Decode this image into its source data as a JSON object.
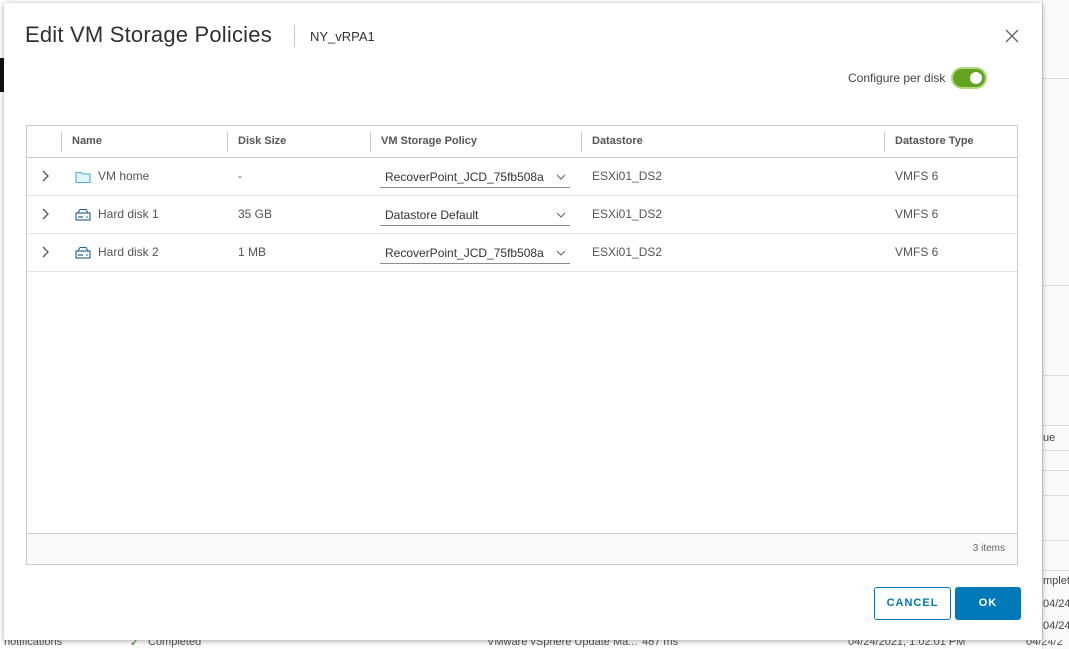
{
  "dialog": {
    "title": "Edit VM Storage Policies",
    "vm_name": "NY_vRPA1",
    "toggle_label": "Configure per disk",
    "toggle_on": true
  },
  "grid": {
    "columns": [
      "Name",
      "Disk Size",
      "VM Storage Policy",
      "Datastore",
      "Datastore Type"
    ],
    "rows": [
      {
        "icon": "folder-icon",
        "name": "VM home",
        "disk_size": "-",
        "policy": "RecoverPoint_JCD_75fb508a",
        "datastore": "ESXi01_DS2",
        "datastore_type": "VMFS 6"
      },
      {
        "icon": "hard-disk-icon",
        "name": "Hard disk 1",
        "disk_size": "35 GB",
        "policy": "Datastore Default",
        "datastore": "ESXi01_DS2",
        "datastore_type": "VMFS 6"
      },
      {
        "icon": "hard-disk-icon",
        "name": "Hard disk 2",
        "disk_size": "1 MB",
        "policy": "RecoverPoint_JCD_75fb508a",
        "datastore": "ESXi01_DS2",
        "datastore_type": "VMFS 6"
      }
    ],
    "footer_count": "3 items"
  },
  "buttons": {
    "cancel": "CANCEL",
    "ok": "OK"
  },
  "background": {
    "right_panel_items": [
      "ue",
      "mplet",
      "04/24/2",
      "04/24/2"
    ],
    "bottom_row": [
      "notifications",
      "Completed",
      "VMware vSphere Update Ma...",
      "487 ms",
      "04/24/2021, 1:02:01 PM",
      "04/24/2"
    ]
  },
  "colors": {
    "accent": "#0079b8",
    "toggle": "#62a420",
    "folder": "#49afd9"
  }
}
